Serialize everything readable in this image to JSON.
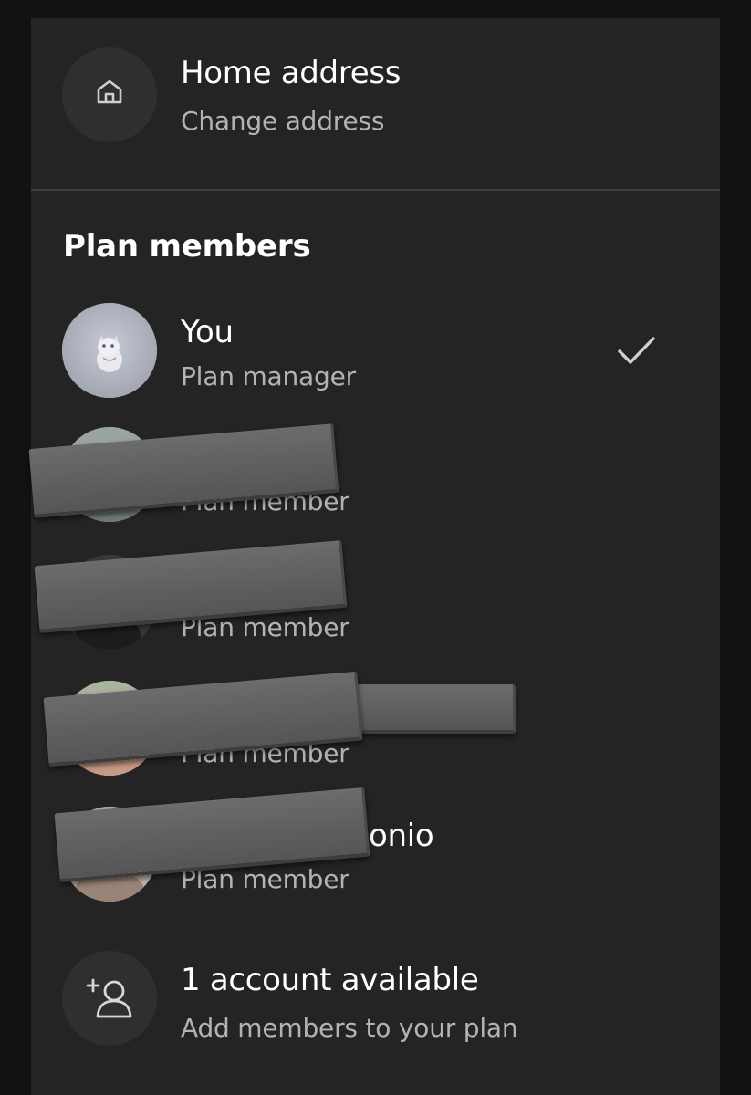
{
  "home_address": {
    "title": "Home address",
    "subtitle": "Change address",
    "icon": "home-icon"
  },
  "plan_members": {
    "heading": "Plan members",
    "members": [
      {
        "name": "You",
        "role": "Plan manager",
        "selected": true
      },
      {
        "name": "",
        "role": "Plan member"
      },
      {
        "name": "",
        "role": "Plan member"
      },
      {
        "name": "",
        "role": "Plan member"
      },
      {
        "name": "onio",
        "role": "Plan member"
      }
    ]
  },
  "add_account": {
    "title": "1 account available",
    "subtitle": "Add members to your plan",
    "icon": "add-user-icon"
  },
  "colors": {
    "background": "#121212",
    "panel": "#242424",
    "text_primary": "#ffffff",
    "text_secondary": "#b3b3b3",
    "redaction": "#626262"
  }
}
